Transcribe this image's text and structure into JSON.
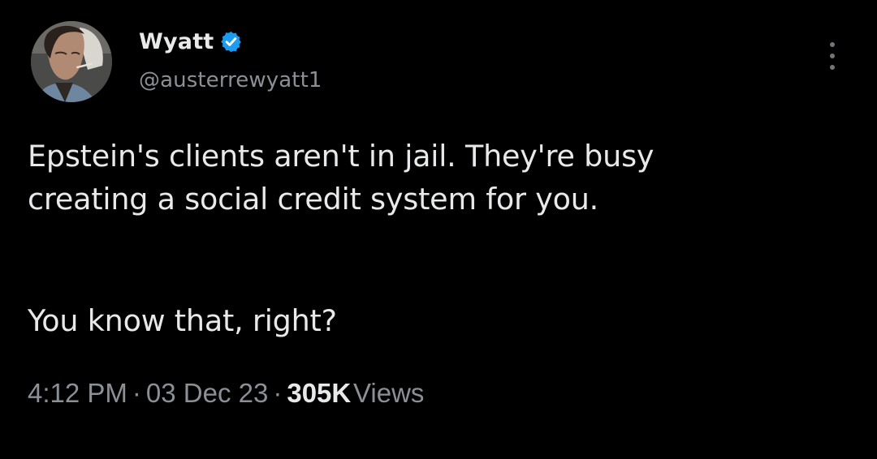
{
  "tweet": {
    "author": {
      "display_name": "Wyatt",
      "handle": "@austerrewyatt1",
      "verified": true,
      "avatar_icon": "profile-photo"
    },
    "body": {
      "line1": "Epstein's clients aren't in jail. They're busy",
      "line2": "creating a social credit system for you.",
      "line3": "You know that, right?"
    },
    "meta": {
      "time": "4:12 PM",
      "separator": "·",
      "date": "03 Dec 23",
      "views_count": "305K",
      "views_label": "Views"
    },
    "more_icon": "more-vertical-icon"
  },
  "colors": {
    "background": "#000000",
    "primary_text": "#e7e9ea",
    "secondary_text": "#8b9096",
    "verified_blue": "#1d9bf0"
  }
}
